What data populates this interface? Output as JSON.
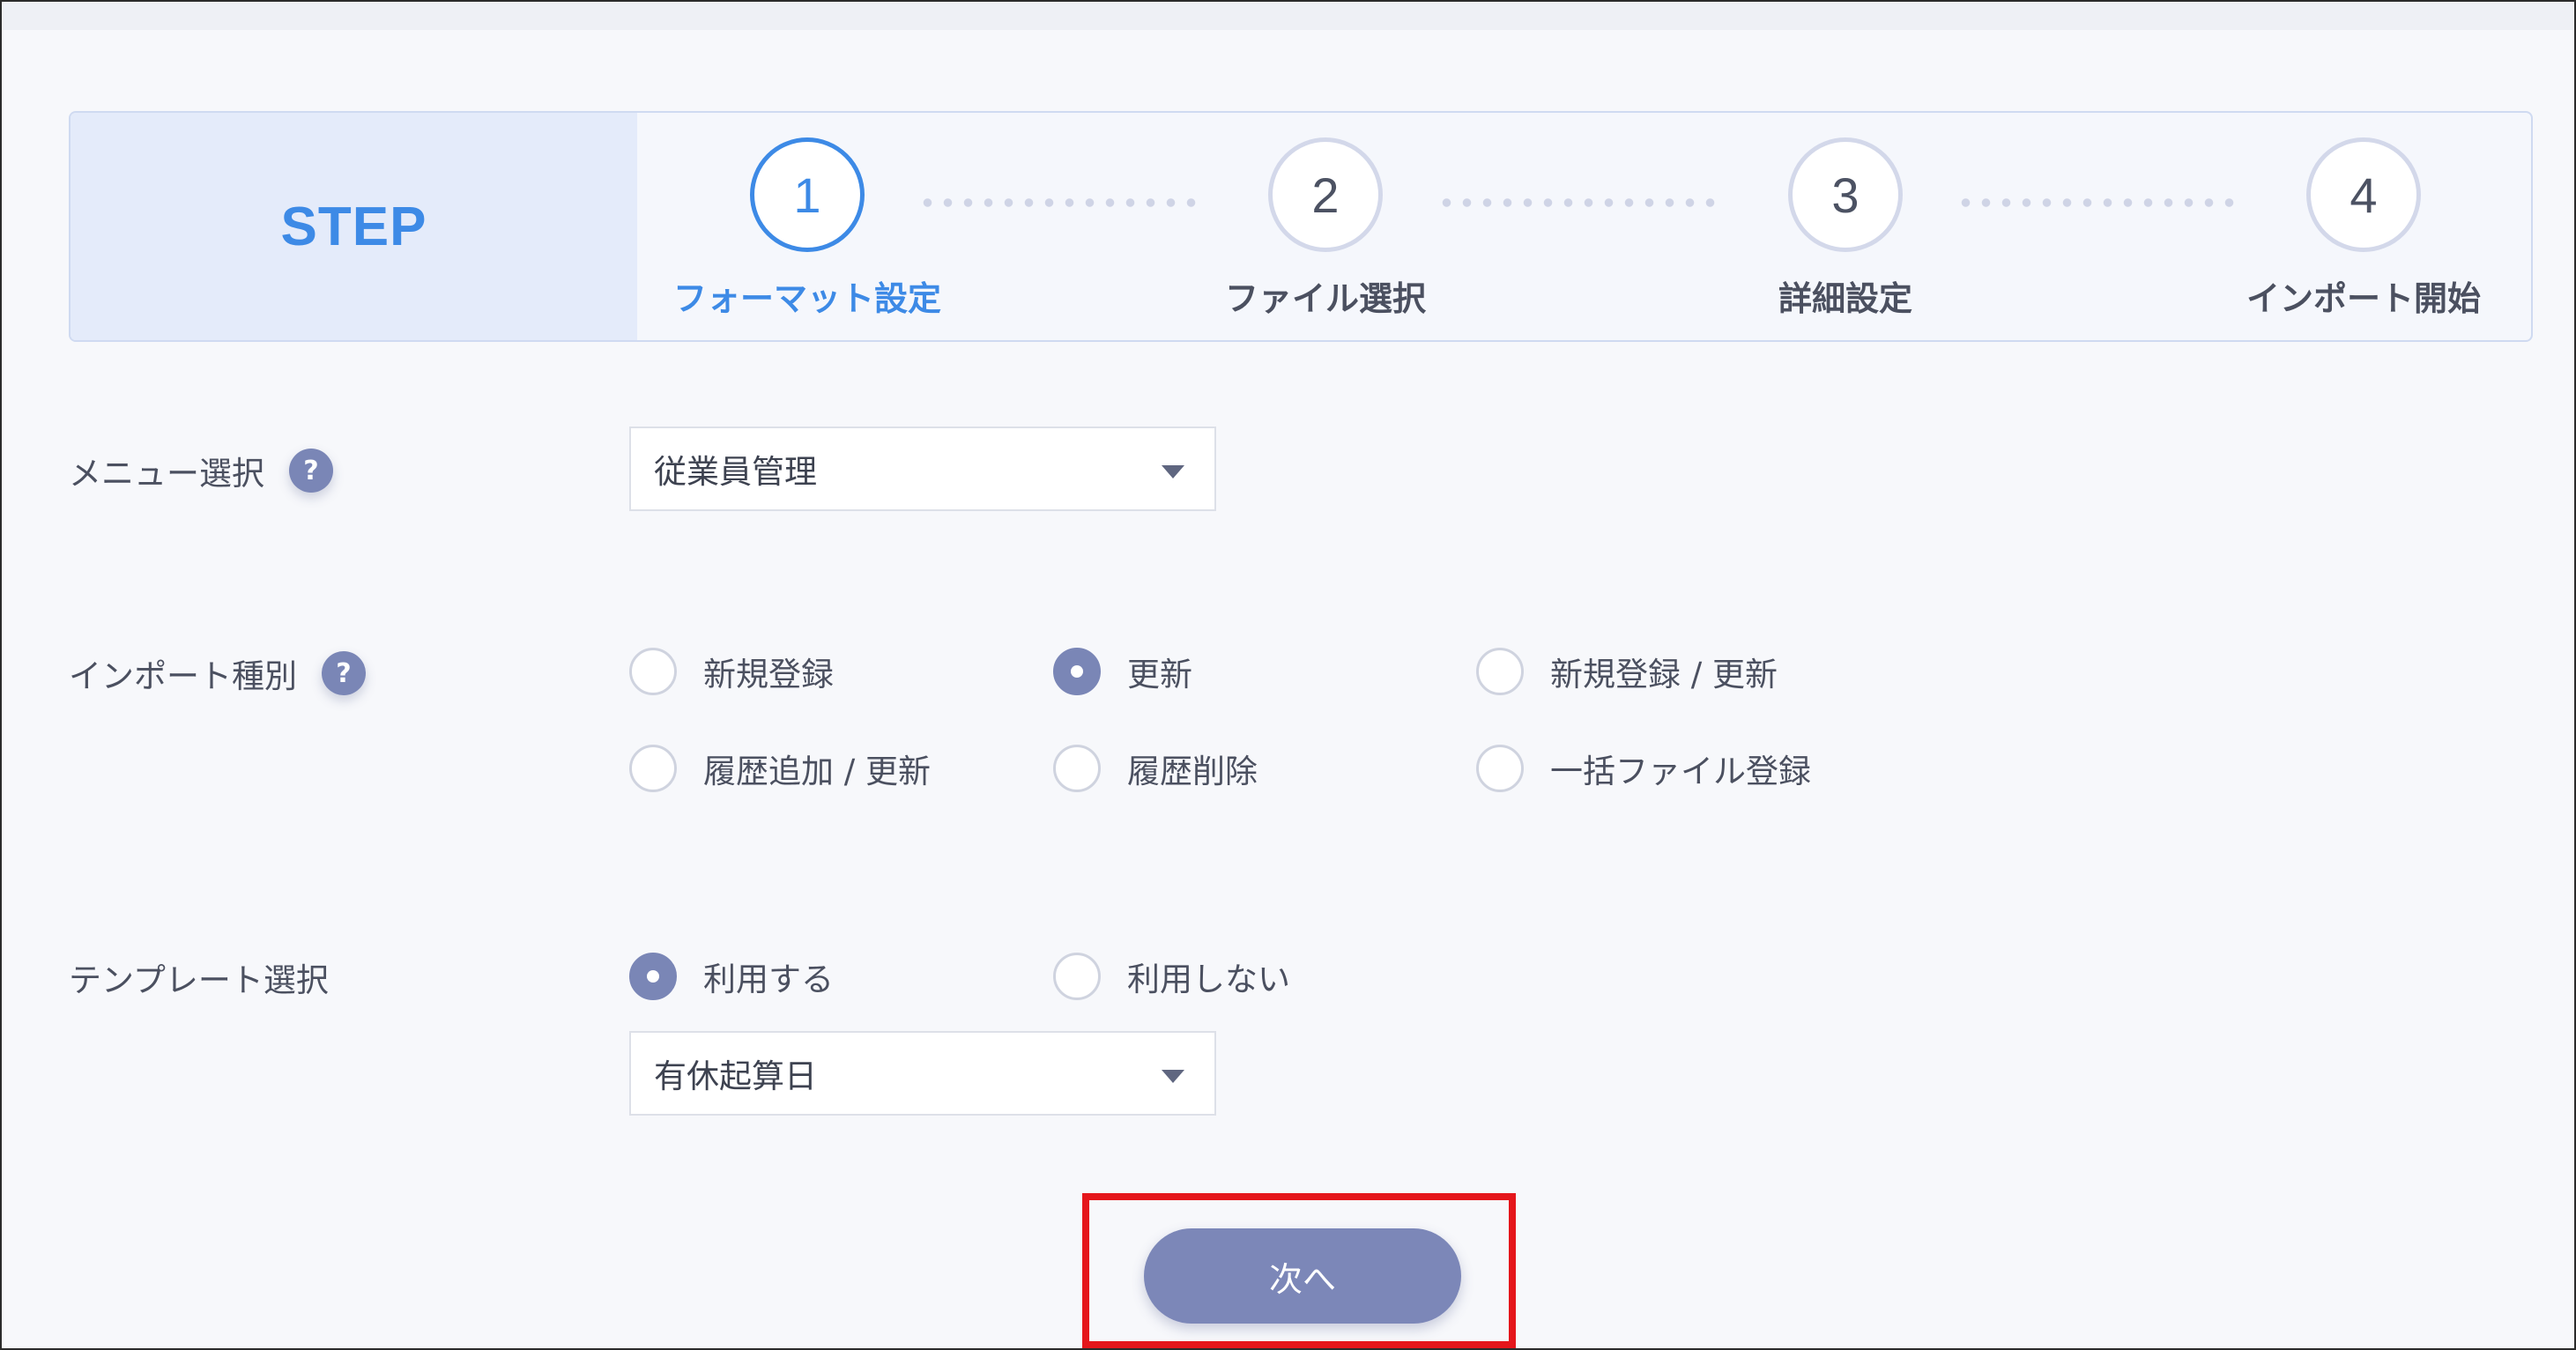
{
  "stepper": {
    "title": "STEP",
    "steps": [
      {
        "number": "1",
        "label": "フォーマット設定",
        "active": true
      },
      {
        "number": "2",
        "label": "ファイル選択",
        "active": false
      },
      {
        "number": "3",
        "label": "詳細設定",
        "active": false
      },
      {
        "number": "4",
        "label": "インポート開始",
        "active": false
      }
    ]
  },
  "menu_select": {
    "label": "メニュー選択",
    "help_icon": "?",
    "value": "従業員管理"
  },
  "import_type": {
    "label": "インポート種別",
    "help_icon": "?",
    "options": [
      {
        "label": "新規登録",
        "checked": false
      },
      {
        "label": "更新",
        "checked": true
      },
      {
        "label": "新規登録 / 更新",
        "checked": false
      },
      {
        "label": "履歴追加 / 更新",
        "checked": false
      },
      {
        "label": "履歴削除",
        "checked": false
      },
      {
        "label": "一括ファイル登録",
        "checked": false
      }
    ]
  },
  "template_select": {
    "label": "テンプレート選択",
    "options": [
      {
        "label": "利用する",
        "checked": true
      },
      {
        "label": "利用しない",
        "checked": false
      }
    ],
    "value": "有休起算日"
  },
  "next_button": {
    "label": "次へ"
  },
  "colors": {
    "accent_blue": "#3d8ae6",
    "button_purple": "#7c87b8",
    "highlight_red": "#e5161b"
  }
}
